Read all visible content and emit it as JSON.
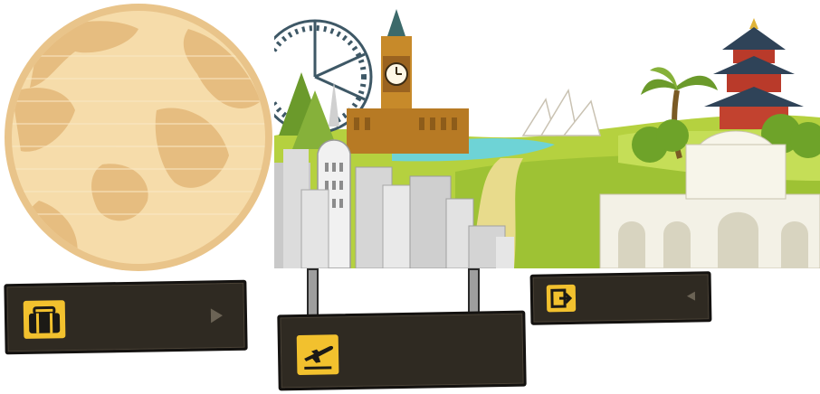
{
  "globe": {
    "icon": "globe-icon",
    "colors": {
      "base": "#f4d7a0",
      "land": "#e4b878",
      "rim": "#e9c48a"
    }
  },
  "scene": {
    "icon": "world-landmarks-illustration",
    "colors": {
      "sky": "#ffffff",
      "grass": "#a8c93a",
      "water": "#6ed3d6"
    }
  },
  "signs": {
    "baggage": {
      "label": "",
      "icon": "baggage-icon"
    },
    "departure": {
      "label": "",
      "icon": "departure-plane-icon"
    },
    "exit": {
      "label": "",
      "icon": "exit-icon"
    }
  },
  "colors": {
    "sign_bg": "#2f2a22",
    "sign_border": "#141210",
    "icon_yellow": "#f2c12e"
  }
}
